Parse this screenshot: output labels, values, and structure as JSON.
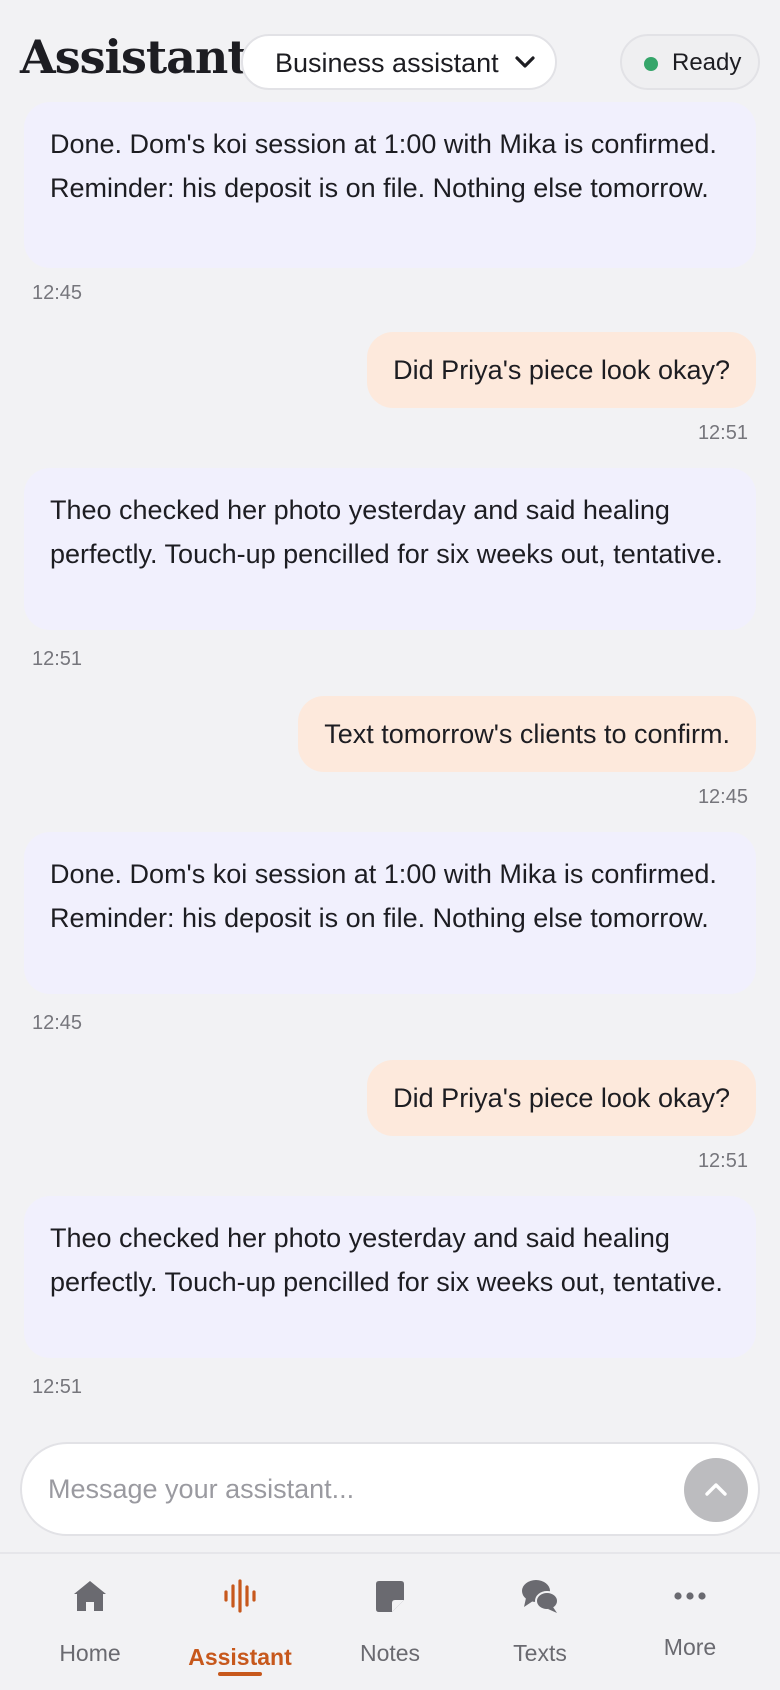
{
  "header": {
    "title": "Assistant",
    "mode_select": {
      "selected": "Business assistant"
    },
    "status": {
      "label": "Ready",
      "color": "#35a56a"
    }
  },
  "messages": [
    {
      "role": "assistant",
      "text": "Done. Dom's koi session at 1:00 with Mika is confirmed. Reminder: his deposit is on file. Nothing else tomorrow.",
      "time": "12:45"
    },
    {
      "role": "user",
      "text": "Did Priya's piece look okay?",
      "time": "12:51"
    },
    {
      "role": "assistant",
      "text": "Theo checked her photo yesterday and said healing perfectly. Touch-up pencilled for six weeks out, tentative.",
      "time": "12:51"
    },
    {
      "role": "user",
      "text": "Text tomorrow's clients to confirm.",
      "time": "12:45"
    },
    {
      "role": "assistant",
      "text": "Done. Dom's koi session at 1:00 with Mika is confirmed. Reminder: his deposit is on file. Nothing else tomorrow.",
      "time": "12:45"
    },
    {
      "role": "user",
      "text": "Did Priya's piece look okay?",
      "time": "12:51"
    },
    {
      "role": "assistant",
      "text": "Theo checked her photo yesterday and said healing perfectly. Touch-up pencilled for six weeks out, tentative.",
      "time": "12:51"
    }
  ],
  "composer": {
    "placeholder": "Message your assistant...",
    "send_icon": "chevron-up-icon"
  },
  "nav": {
    "items": [
      {
        "label": "Home",
        "icon": "home-icon"
      },
      {
        "label": "Assistant",
        "icon": "soundwave-icon",
        "active": true
      },
      {
        "label": "Notes",
        "icon": "note-icon"
      },
      {
        "label": "Texts",
        "icon": "chat-bubbles-icon"
      },
      {
        "label": "More",
        "icon": "more-dots-icon"
      }
    ]
  },
  "colors": {
    "accent": "#c7581c",
    "assistant_bubble": "#f1f0fd",
    "user_bubble": "#fde9dc",
    "background": "#f2f2f4"
  }
}
